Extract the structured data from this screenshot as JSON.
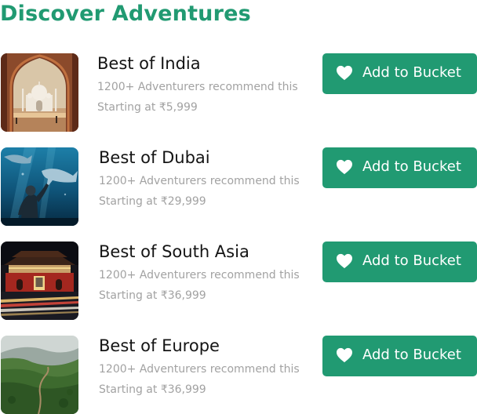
{
  "page": {
    "title": "Discover Adventures"
  },
  "colors": {
    "brand_green": "#219a72",
    "text_dark": "#141414",
    "text_muted": "#a2a2a2"
  },
  "adventures": [
    {
      "name": "Best of India",
      "recommend": "1200+ Adventurers recommend this",
      "price": "Starting at ₹5,999",
      "button_label": "Add to Bucket",
      "button_icon": "heart-icon",
      "image": "taj-mahal-through-arch"
    },
    {
      "name": "Best of Dubai",
      "recommend": "1200+ Adventurers recommend this",
      "price": "Starting at ₹29,999",
      "button_label": "Add to Bucket",
      "button_icon": "heart-icon",
      "image": "aquarium-shark-tunnel"
    },
    {
      "name": "Best of South Asia",
      "recommend": "1200+ Adventurers recommend this",
      "price": "Starting at ₹36,999",
      "button_label": "Add to Bucket",
      "button_icon": "heart-icon",
      "image": "tiananmen-gate-night"
    },
    {
      "name": "Best of Europe",
      "recommend": "1200+ Adventurers recommend this",
      "price": "Starting at ₹36,999",
      "button_label": "Add to Bucket",
      "button_icon": "heart-icon",
      "image": "green-mountain-ridge"
    }
  ]
}
